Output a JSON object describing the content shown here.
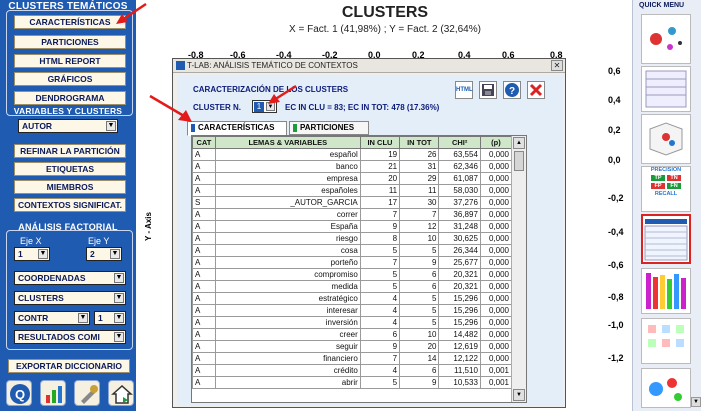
{
  "left_panel": {
    "clusters_title": "CLUSTERS TEMÁTICOS",
    "buttons": [
      "CARACTERÍSTICAS",
      "PARTICIONES",
      "HTML REPORT",
      "GRÁFICOS",
      "DENDROGRAMA"
    ],
    "vars_title": "VARIABLES Y CLUSTERS",
    "vars_select": "AUTOR",
    "buttons2": [
      "REFINAR LA PARTICIÓN",
      "ETIQUETAS",
      "MIEMBROS",
      "CONTEXTOS SIGNIFICAT."
    ],
    "factorial_title": "ANÁLISIS FACTORIAL",
    "eje_x_label": "Eje X",
    "eje_y_label": "Eje Y",
    "eje_x_value": "1",
    "eje_y_value": "2",
    "select_coord": "COORDENADAS",
    "select_clusters": "CLUSTERS",
    "select_contr": "CONTR",
    "select_contr_num": "1",
    "select_results": "RESULTADOS COMI",
    "export_button": "EXPORTAR DICCIONARIO"
  },
  "chart": {
    "title": "CLUSTERS",
    "subtitle": "X = Fact. 1 (41,98%) ; Y = Fact. 2 (32,64%)",
    "x_ticks": [
      "-0,8",
      "-0,6",
      "-0,4",
      "-0,2",
      "0,0",
      "0,2",
      "0,4",
      "0,6",
      "0,8"
    ],
    "y_ticks": [
      "0,6",
      "0,4",
      "0,2",
      "0,0",
      "-0,2",
      "-0,4",
      "-0,6",
      "-0,8",
      "-1,0",
      "-1,2"
    ],
    "y_axis_label": "Y - Axis"
  },
  "quick_menu": {
    "title": "QUICK MENU",
    "precision": "PRECISION",
    "recall": "RECALL",
    "tp": "TP",
    "tn": "TN",
    "fp": "FP",
    "fn": "FN"
  },
  "dialog": {
    "title": "T-LAB: ANÁLISIS TEMÁTICO DE CONTEXTOS",
    "heading": "CARACTERIZACIÓN DE LOS CLUSTERS",
    "cluster_label": "CLUSTER N.",
    "cluster_value": "1",
    "info": "EC IN CLU = 83; EC IN TOT: 478 (17.36%)",
    "html_icon": "HTML",
    "tabs": [
      "CARACTERÍSTICAS",
      "PARTICIONES"
    ],
    "columns": [
      "CAT",
      "LEMAS & VARIABLES",
      "IN CLU",
      "IN TOT",
      "CHI²",
      "(p)"
    ],
    "rows": [
      [
        "A",
        "español",
        "19",
        "26",
        "63,554",
        "0,000"
      ],
      [
        "A",
        "banco",
        "21",
        "31",
        "62,346",
        "0,000"
      ],
      [
        "A",
        "empresa",
        "20",
        "29",
        "61,087",
        "0,000"
      ],
      [
        "A",
        "españoles",
        "11",
        "11",
        "58,030",
        "0,000"
      ],
      [
        "S",
        "_AUTOR_GARCIA",
        "17",
        "30",
        "37,276",
        "0,000"
      ],
      [
        "A",
        "correr",
        "7",
        "7",
        "36,897",
        "0,000"
      ],
      [
        "A",
        "España",
        "9",
        "12",
        "31,248",
        "0,000"
      ],
      [
        "A",
        "riesgo",
        "8",
        "10",
        "30,625",
        "0,000"
      ],
      [
        "A",
        "cosa",
        "5",
        "5",
        "26,344",
        "0,000"
      ],
      [
        "A",
        "porteño",
        "7",
        "9",
        "25,677",
        "0,000"
      ],
      [
        "A",
        "compromiso",
        "5",
        "6",
        "20,321",
        "0,000"
      ],
      [
        "A",
        "medida",
        "5",
        "6",
        "20,321",
        "0,000"
      ],
      [
        "A",
        "estratégico",
        "4",
        "5",
        "15,296",
        "0,000"
      ],
      [
        "A",
        "interesar",
        "4",
        "5",
        "15,296",
        "0,000"
      ],
      [
        "A",
        "inversión",
        "4",
        "5",
        "15,296",
        "0,000"
      ],
      [
        "A",
        "creer",
        "6",
        "10",
        "14,482",
        "0,000"
      ],
      [
        "A",
        "seguir",
        "9",
        "20",
        "12,619",
        "0,000"
      ],
      [
        "A",
        "financiero",
        "7",
        "14",
        "12,122",
        "0,000"
      ],
      [
        "A",
        "crédito",
        "4",
        "6",
        "11,510",
        "0,001"
      ],
      [
        "A",
        "abrir",
        "5",
        "9",
        "10,533",
        "0,001"
      ]
    ]
  },
  "colors": {
    "panel": "#1f5bb0",
    "header": "#cfe7c8",
    "arrow": "#e31b1b"
  }
}
